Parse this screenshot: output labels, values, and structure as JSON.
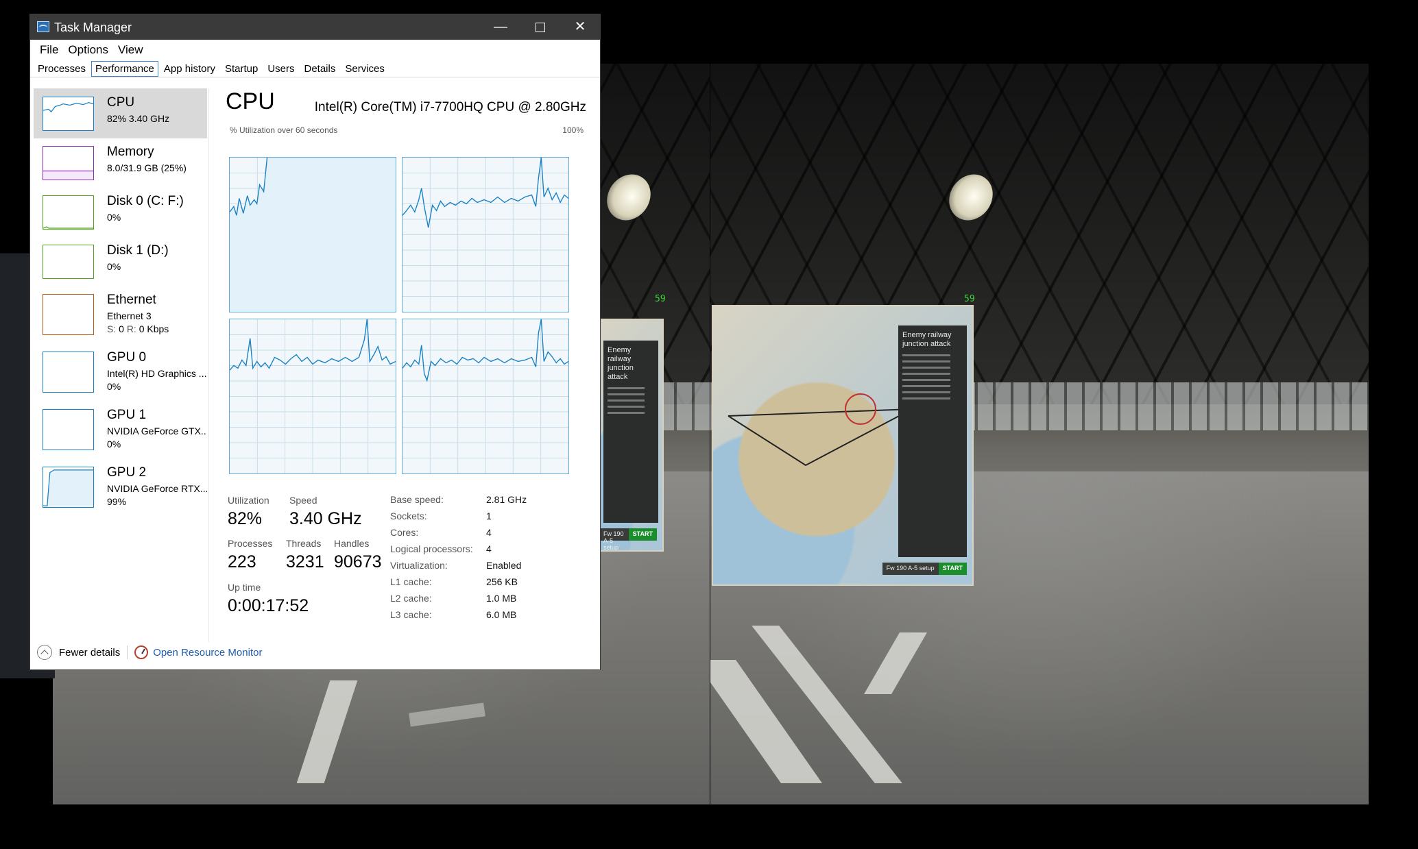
{
  "window": {
    "title": "Task Manager"
  },
  "menu": [
    "File",
    "Options",
    "View"
  ],
  "tabs": [
    "Processes",
    "Performance",
    "App history",
    "Startup",
    "Users",
    "Details",
    "Services"
  ],
  "active_tab": "Performance",
  "sidebar": [
    {
      "name": "CPU",
      "sub": "82% 3.40 GHz",
      "color": "#1a82c4"
    },
    {
      "name": "Memory",
      "sub": "8.0/31.9 GB (25%)",
      "color": "#8b2fb4"
    },
    {
      "name": "Disk 0 (C: F:)",
      "sub": "0%",
      "color": "#4da61b"
    },
    {
      "name": "Disk 1 (D:)",
      "sub": "0%",
      "color": "#4da61b"
    },
    {
      "name": "Ethernet",
      "sub": "Ethernet 3",
      "sub2_s": "S:",
      "sub2_sv": "0",
      "sub2_r": "R:",
      "sub2_rv": "0 Kbps",
      "color": "#b55a17"
    },
    {
      "name": "GPU 0",
      "sub": "Intel(R) HD Graphics ...",
      "sub2": "0%",
      "color": "#1a82c4"
    },
    {
      "name": "GPU 1",
      "sub": "NVIDIA GeForce GTX...",
      "sub2": "0%",
      "color": "#1a82c4"
    },
    {
      "name": "GPU 2",
      "sub": "NVIDIA GeForce RTX...",
      "sub2": "99%",
      "color": "#1a82c4"
    }
  ],
  "cpu": {
    "heading": "CPU",
    "model": "Intel(R) Core(TM) i7-7700HQ CPU @ 2.80GHz",
    "graph_label": "% Utilization over 60 seconds",
    "graph_max": "100%",
    "utilization_label": "Utilization",
    "utilization": "82%",
    "speed_label": "Speed",
    "speed": "3.40 GHz",
    "processes_label": "Processes",
    "processes": "223",
    "threads_label": "Threads",
    "threads": "3231",
    "handles_label": "Handles",
    "handles": "90673",
    "uptime_label": "Up time",
    "uptime": "0:00:17:52",
    "specs": [
      {
        "k": "Base speed:",
        "v": "2.81 GHz"
      },
      {
        "k": "Sockets:",
        "v": "1"
      },
      {
        "k": "Cores:",
        "v": "4"
      },
      {
        "k": "Logical processors:",
        "v": "4"
      },
      {
        "k": "Virtualization:",
        "v": "Enabled"
      },
      {
        "k": "L1 cache:",
        "v": "256 KB"
      },
      {
        "k": "L2 cache:",
        "v": "1.0 MB"
      },
      {
        "k": "L3 cache:",
        "v": "6.0 MB"
      }
    ]
  },
  "footer": {
    "fewer_details": "Fewer details",
    "open_resmon": "Open Resource Monitor"
  },
  "game": {
    "fps_left": "59",
    "fps_right": "59",
    "panel_title": "Enemy railway junction attack",
    "setup_label": "Fw 190 A-5 setup",
    "start_label": "START"
  },
  "colors": {
    "accent": "#1a82c4",
    "graph_line": "#1a82c4"
  }
}
